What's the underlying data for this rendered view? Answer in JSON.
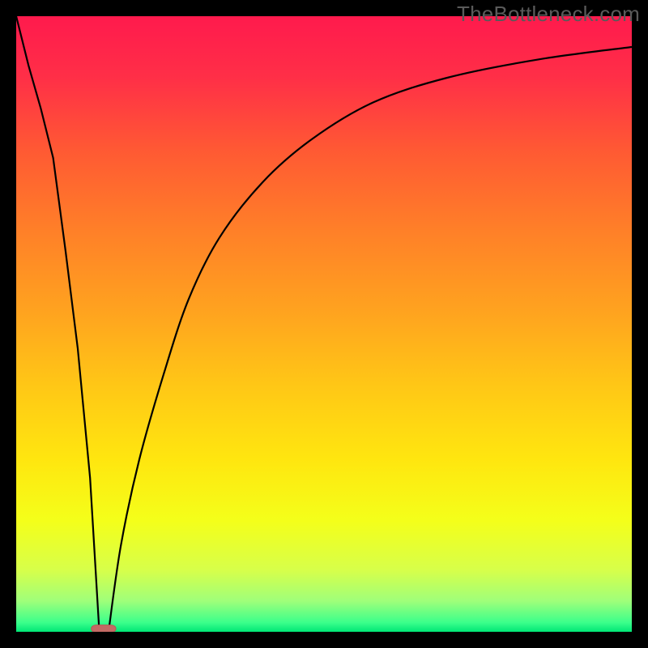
{
  "watermark": "TheBottleneck.com",
  "colors": {
    "frame": "#000000",
    "gradient_stops": [
      {
        "offset": 0.0,
        "color": "#ff1a4d"
      },
      {
        "offset": 0.1,
        "color": "#ff2f47"
      },
      {
        "offset": 0.22,
        "color": "#ff5a33"
      },
      {
        "offset": 0.35,
        "color": "#ff8028"
      },
      {
        "offset": 0.48,
        "color": "#ffa31f"
      },
      {
        "offset": 0.6,
        "color": "#ffc716"
      },
      {
        "offset": 0.72,
        "color": "#ffe60f"
      },
      {
        "offset": 0.82,
        "color": "#f4ff1a"
      },
      {
        "offset": 0.9,
        "color": "#d7ff4a"
      },
      {
        "offset": 0.95,
        "color": "#9fff7a"
      },
      {
        "offset": 0.985,
        "color": "#3bff8b"
      },
      {
        "offset": 1.0,
        "color": "#00e676"
      }
    ],
    "curve": "#000000",
    "marker_fill": "#c46a64",
    "marker_stroke": "#b85a55"
  },
  "chart_data": {
    "type": "line",
    "title": "",
    "xlabel": "",
    "ylabel": "",
    "xlim": [
      0,
      100
    ],
    "ylim": [
      0,
      100
    ],
    "grid": false,
    "series": [
      {
        "name": "left-branch",
        "x": [
          0,
          2,
          4,
          6,
          8,
          10,
          12,
          13.5
        ],
        "y": [
          100,
          92,
          85,
          77,
          62,
          46,
          25,
          0
        ]
      },
      {
        "name": "right-branch",
        "x": [
          15,
          17,
          20,
          24,
          28,
          33,
          40,
          48,
          58,
          70,
          85,
          100
        ],
        "y": [
          0,
          14,
          28,
          42,
          54,
          64,
          73,
          80,
          86,
          90,
          93,
          95
        ]
      }
    ],
    "marker": {
      "x": 14.2,
      "y": 0.5,
      "rx": 4.0,
      "ry": 1.2
    },
    "notes": "Axes are unlabeled in the source image; x/y are normalized 0–100 readings from the plot area. y=0 corresponds to the green bottom edge (best), y=100 to the red top edge (worst). The marker is the small rounded pink rectangle at the curve's minimum."
  }
}
